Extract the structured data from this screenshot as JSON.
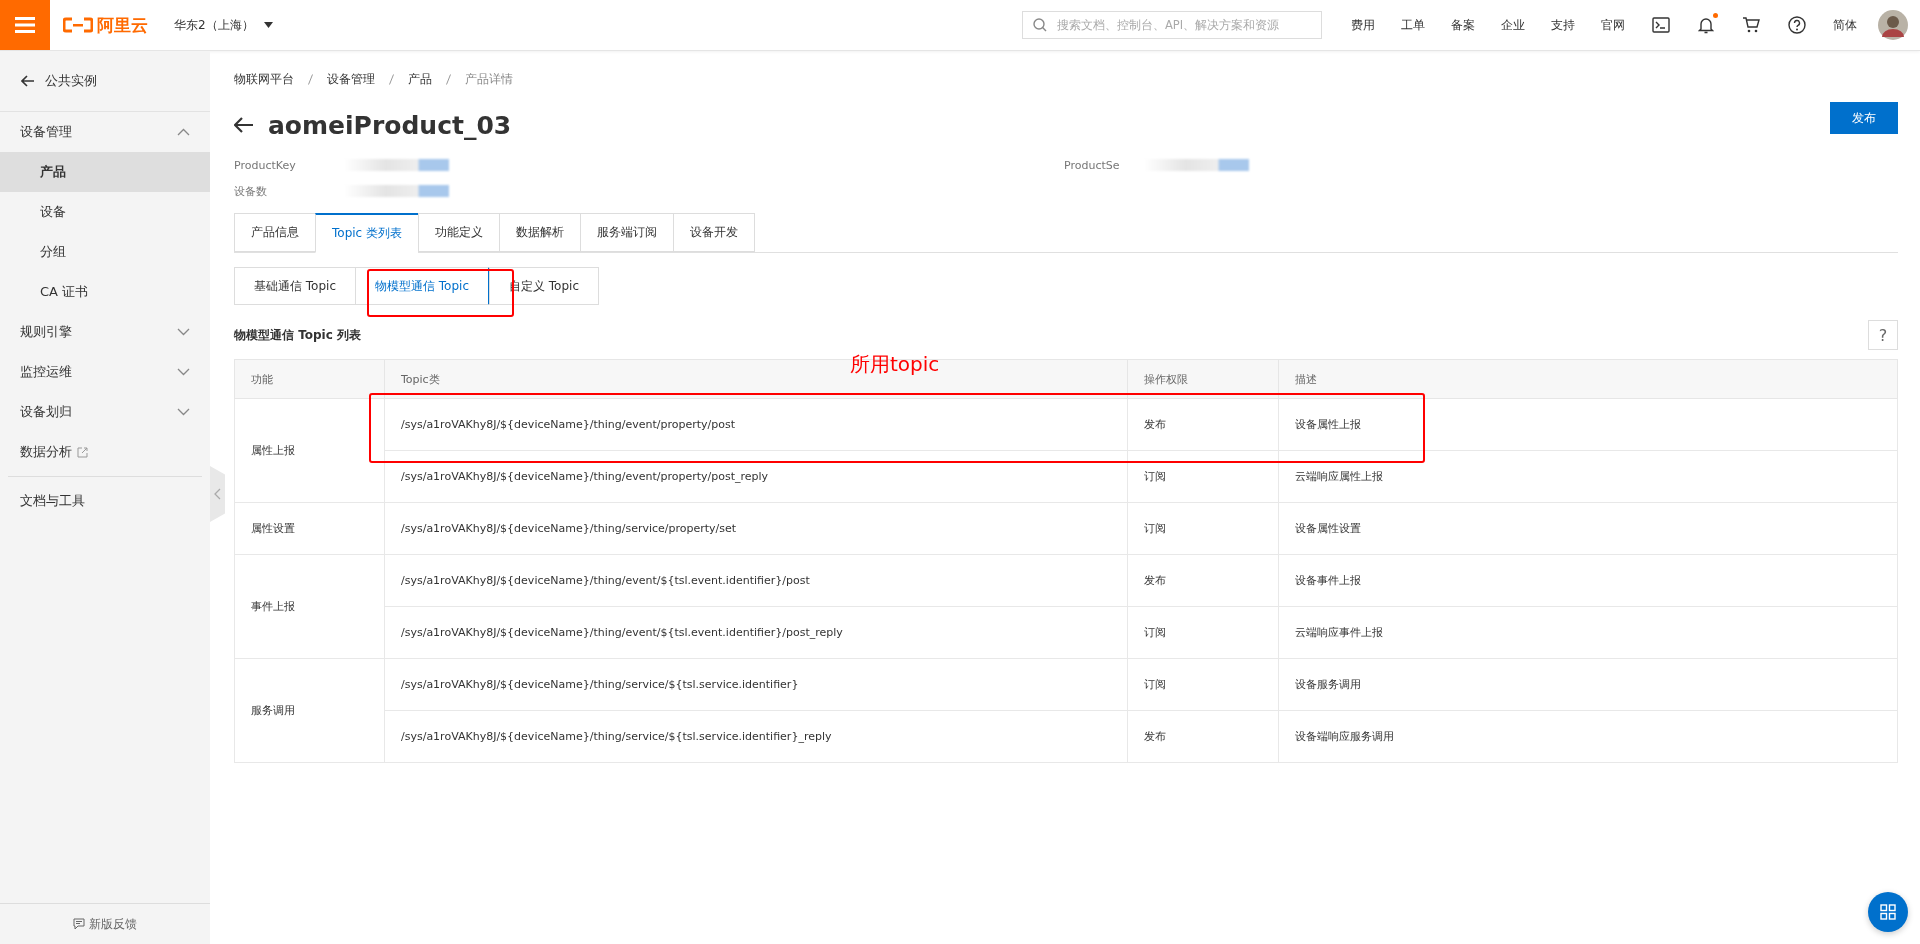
{
  "topbar": {
    "logo_text": "阿里云",
    "region": "华东2（上海）",
    "search_placeholder": "搜索文档、控制台、API、解决方案和资源",
    "links": [
      "费用",
      "工单",
      "备案",
      "企业",
      "支持",
      "官网"
    ],
    "has_notification": true,
    "language": "简体"
  },
  "sidebar": {
    "back": "公共实例",
    "items": [
      {
        "label": "设备管理",
        "expanded": true,
        "children": [
          {
            "label": "产品",
            "selected": true
          },
          {
            "label": "设备",
            "selected": false
          },
          {
            "label": "分组",
            "selected": false
          },
          {
            "label": "CA 证书",
            "selected": false
          }
        ]
      },
      {
        "label": "规则引擎",
        "expanded": false
      },
      {
        "label": "监控运维",
        "expanded": false
      },
      {
        "label": "设备划归",
        "expanded": false
      },
      {
        "label": "数据分析",
        "external": true
      }
    ],
    "bottom": "文档与工具",
    "feedback": "新版反馈"
  },
  "breadcrumb": [
    "物联网平台",
    "设备管理",
    "产品",
    "产品详情"
  ],
  "title": "aomeiProduct_03",
  "publish_button": "发布",
  "fields": [
    {
      "label": "ProductKey"
    },
    {
      "label": "设备数"
    }
  ],
  "secret_label": "ProductSe",
  "tabs": [
    {
      "label": "产品信息",
      "selected": false
    },
    {
      "label": "Topic 类列表",
      "selected": true
    },
    {
      "label": "功能定义",
      "selected": false
    },
    {
      "label": "数据解析",
      "selected": false
    },
    {
      "label": "服务端订阅",
      "selected": false
    },
    {
      "label": "设备开发",
      "selected": false
    }
  ],
  "subtabs": [
    {
      "label": "基础通信 Topic",
      "selected": false
    },
    {
      "label": "物模型通信 Topic",
      "selected": true
    },
    {
      "label": "自定义 Topic",
      "selected": false
    }
  ],
  "section_title": "物模型通信 Topic 列表",
  "help": "?",
  "table": {
    "columns": [
      "功能",
      "Topic类",
      "操作权限",
      "描述"
    ],
    "groups": [
      {
        "function": "属性上报",
        "rows": [
          {
            "topic": "/sys/a1roVAKhy8J/${deviceName}/thing/event/property/post",
            "permission": "发布",
            "description": "设备属性上报"
          },
          {
            "topic": "/sys/a1roVAKhy8J/${deviceName}/thing/event/property/post_reply",
            "permission": "订阅",
            "description": "云端响应属性上报"
          }
        ]
      },
      {
        "function": "属性设置",
        "rows": [
          {
            "topic": "/sys/a1roVAKhy8J/${deviceName}/thing/service/property/set",
            "permission": "订阅",
            "description": "设备属性设置"
          }
        ]
      },
      {
        "function": "事件上报",
        "rows": [
          {
            "topic": "/sys/a1roVAKhy8J/${deviceName}/thing/event/${tsl.event.identifier}/post",
            "permission": "发布",
            "description": "设备事件上报"
          },
          {
            "topic": "/sys/a1roVAKhy8J/${deviceName}/thing/event/${tsl.event.identifier}/post_reply",
            "permission": "订阅",
            "description": "云端响应事件上报"
          }
        ]
      },
      {
        "function": "服务调用",
        "rows": [
          {
            "topic": "/sys/a1roVAKhy8J/${deviceName}/thing/service/${tsl.service.identifier}",
            "permission": "订阅",
            "description": "设备服务调用"
          },
          {
            "topic": "/sys/a1roVAKhy8J/${deviceName}/thing/service/${tsl.service.identifier}_reply",
            "permission": "发布",
            "description": "设备端响应服务调用"
          }
        ]
      }
    ]
  },
  "annotation": {
    "label": "所用topic"
  }
}
